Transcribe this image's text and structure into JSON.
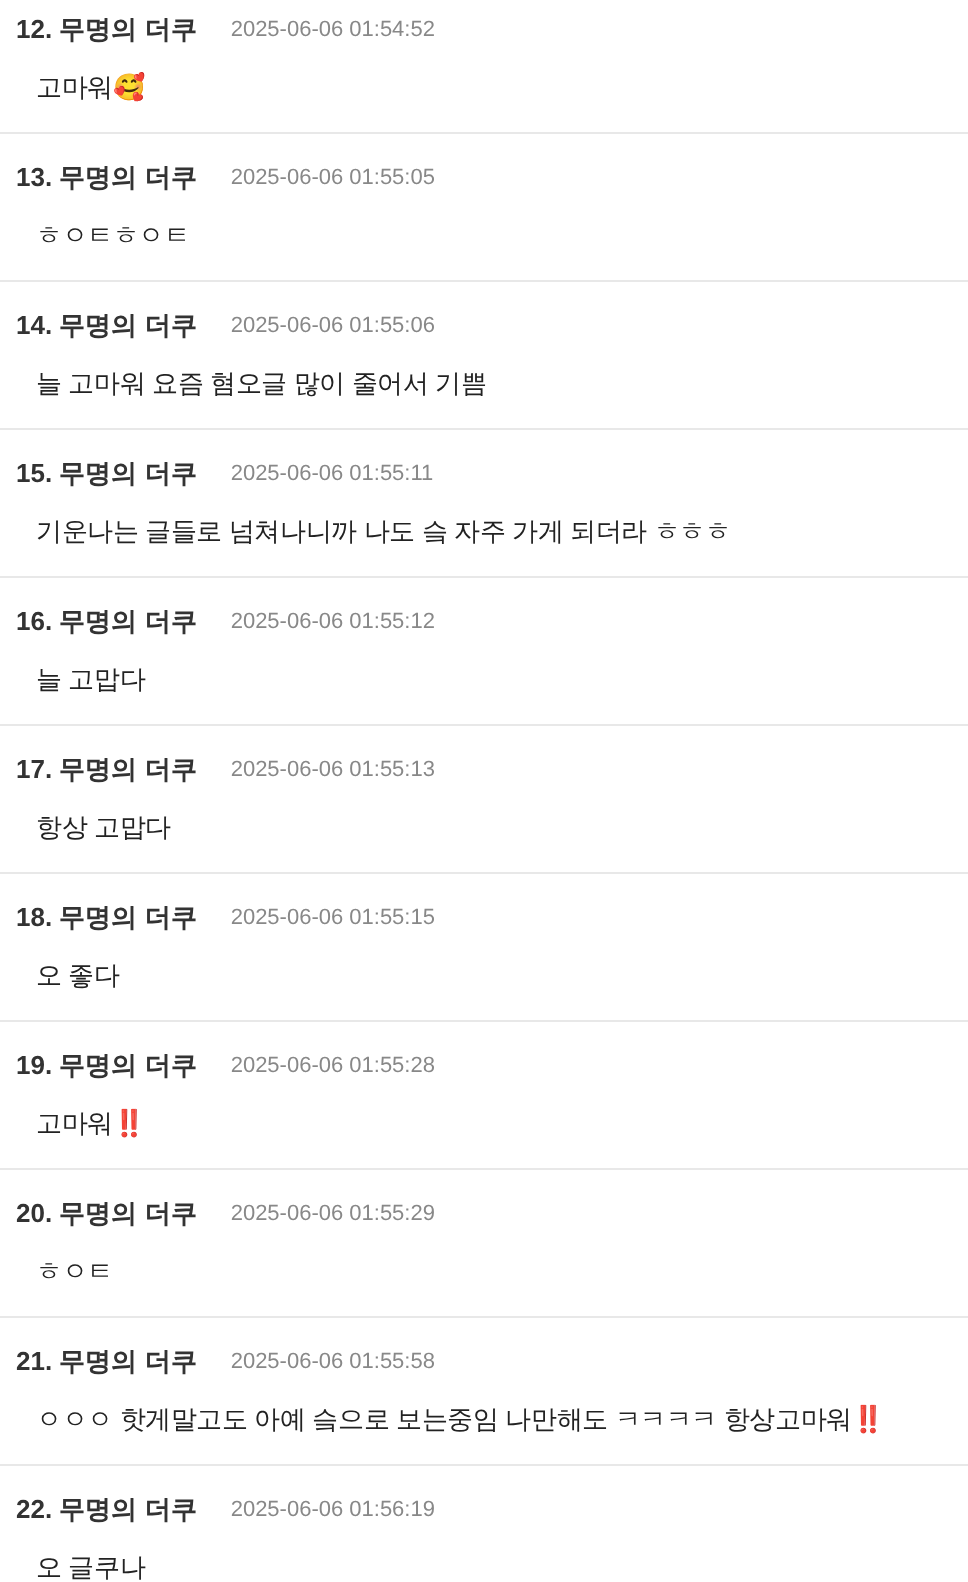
{
  "comments": [
    {
      "number": "12.",
      "author": "무명의 더쿠",
      "time": "2025-06-06 01:54:52",
      "text": "고마워🥰"
    },
    {
      "number": "13.",
      "author": "무명의 더쿠",
      "time": "2025-06-06 01:55:05",
      "text": "ㅎㅇㅌㅎㅇㅌ"
    },
    {
      "number": "14.",
      "author": "무명의 더쿠",
      "time": "2025-06-06 01:55:06",
      "text": "늘 고마워 요즘 혐오글 많이 줄어서 기쁨"
    },
    {
      "number": "15.",
      "author": "무명의 더쿠",
      "time": "2025-06-06 01:55:11",
      "text": "기운나는 글들로 넘쳐나니까 나도 슼 자주 가게 되더라 ㅎㅎㅎ"
    },
    {
      "number": "16.",
      "author": "무명의 더쿠",
      "time": "2025-06-06 01:55:12",
      "text": "늘 고맙다"
    },
    {
      "number": "17.",
      "author": "무명의 더쿠",
      "time": "2025-06-06 01:55:13",
      "text": "항상 고맙다"
    },
    {
      "number": "18.",
      "author": "무명의 더쿠",
      "time": "2025-06-06 01:55:15",
      "text": "오 좋다"
    },
    {
      "number": "19.",
      "author": "무명의 더쿠",
      "time": "2025-06-06 01:55:28",
      "text": "고마워‼️"
    },
    {
      "number": "20.",
      "author": "무명의 더쿠",
      "time": "2025-06-06 01:55:29",
      "text": "ㅎㅇㅌ"
    },
    {
      "number": "21.",
      "author": "무명의 더쿠",
      "time": "2025-06-06 01:55:58",
      "text": "ㅇㅇㅇ 핫게말고도 아예 슼으로 보는중임 나만해도 ㅋㅋㅋㅋ 항상고마워‼️"
    },
    {
      "number": "22.",
      "author": "무명의 더쿠",
      "time": "2025-06-06 01:56:19",
      "text": "오 글쿠나"
    }
  ]
}
